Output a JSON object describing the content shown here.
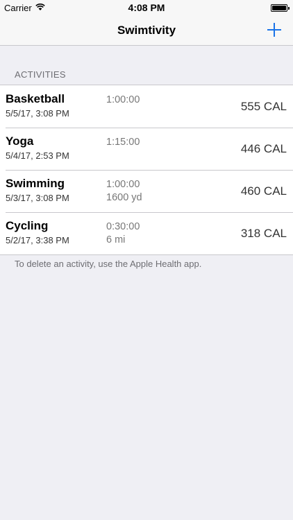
{
  "status_bar": {
    "carrier": "Carrier",
    "time": "4:08 PM"
  },
  "nav": {
    "title": "Swimtivity",
    "add_icon": "plus-icon",
    "accent_color": "#1a73e8"
  },
  "section": {
    "header": "ACTIVITIES",
    "footer": "To delete an activity, use the Apple Health app."
  },
  "activities": [
    {
      "name": "Basketball",
      "date": "5/5/17, 3:08 PM",
      "duration": "1:00:00",
      "distance": "",
      "calories": "555 CAL"
    },
    {
      "name": "Yoga",
      "date": "5/4/17, 2:53 PM",
      "duration": "1:15:00",
      "distance": "",
      "calories": "446 CAL"
    },
    {
      "name": "Swimming",
      "date": "5/3/17, 3:08 PM",
      "duration": "1:00:00",
      "distance": "1600 yd",
      "calories": "460 CAL"
    },
    {
      "name": "Cycling",
      "date": "5/2/17, 3:38 PM",
      "duration": "0:30:00",
      "distance": "6 mi",
      "calories": "318 CAL"
    }
  ]
}
